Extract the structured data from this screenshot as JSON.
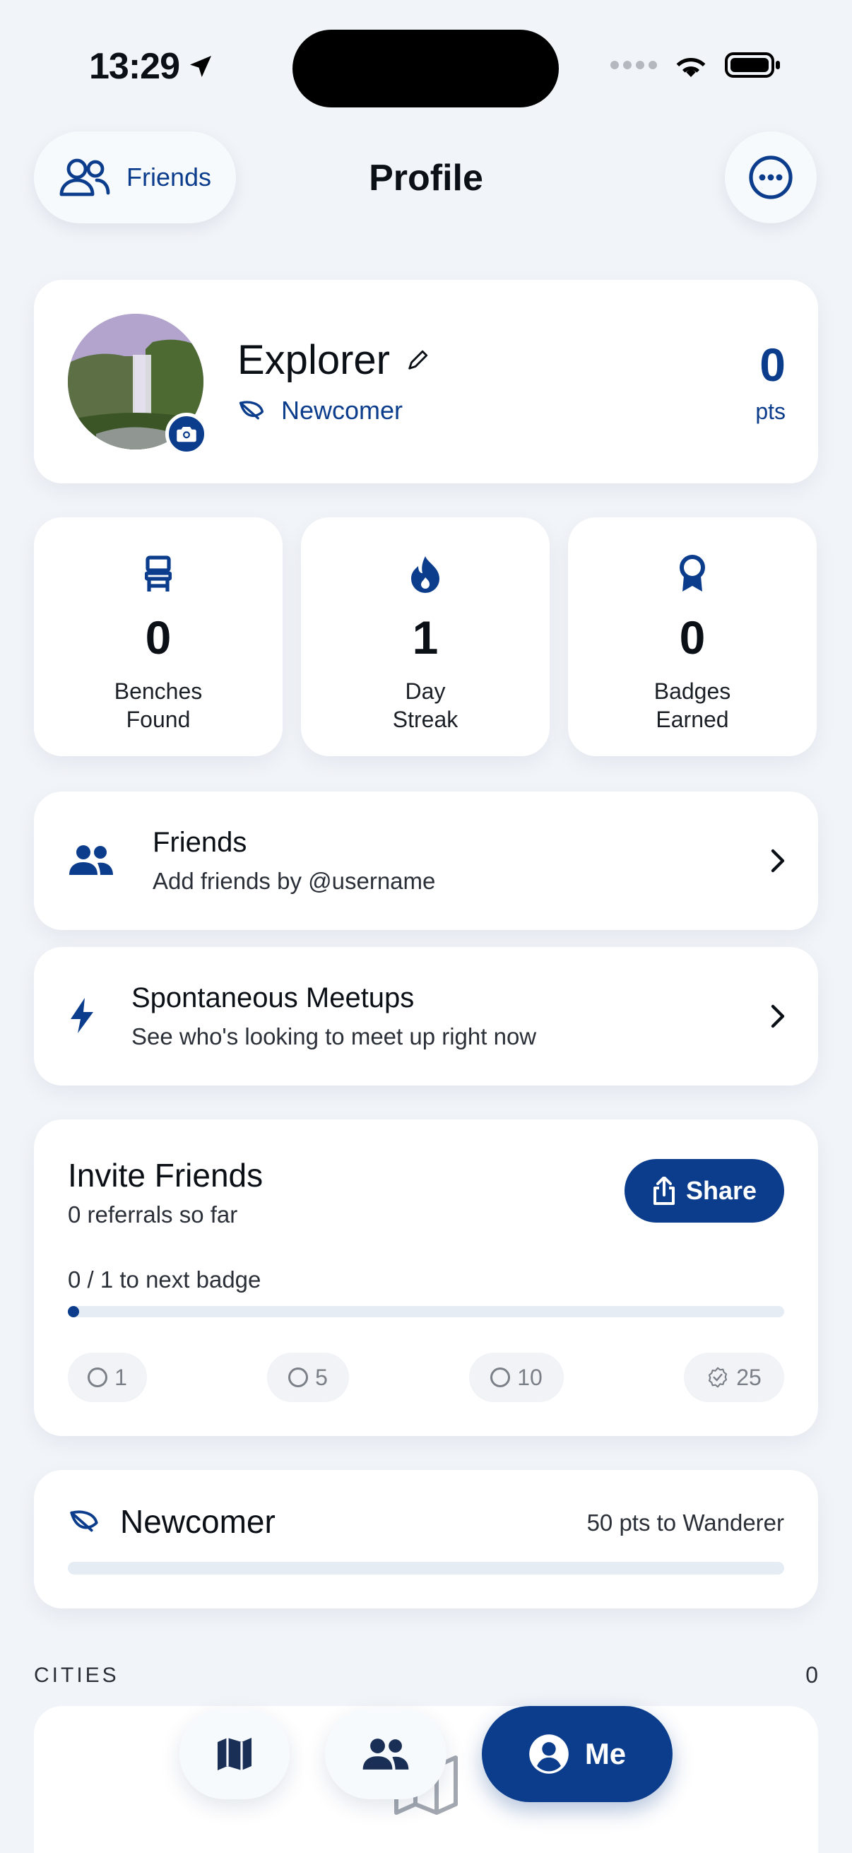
{
  "status_bar": {
    "time": "13:29"
  },
  "header": {
    "friends_label": "Friends",
    "title": "Profile"
  },
  "profile": {
    "name": "Explorer",
    "rank": "Newcomer",
    "points": "0",
    "points_unit": "pts"
  },
  "stats": [
    {
      "value": "0",
      "label": "Benches\nFound",
      "icon": "bench-icon"
    },
    {
      "value": "1",
      "label": "Day\nStreak",
      "icon": "flame-icon"
    },
    {
      "value": "0",
      "label": "Badges\nEarned",
      "icon": "ribbon-icon"
    }
  ],
  "friends_row": {
    "title": "Friends",
    "subtitle": "Add friends by @username"
  },
  "meetups_row": {
    "title": "Spontaneous Meetups",
    "subtitle": "See who's looking to meet up right now"
  },
  "invite": {
    "title": "Invite Friends",
    "subtitle": "0 referrals so far",
    "share_label": "Share",
    "next_badge": "0 / 1 to next badge",
    "progress": 0,
    "milestones": [
      "1",
      "5",
      "10",
      "25"
    ]
  },
  "level": {
    "title": "Newcomer",
    "next": "50 pts to Wanderer",
    "progress": 0
  },
  "cities": {
    "label": "CITIES",
    "count": "0"
  },
  "nav": {
    "me_label": "Me"
  },
  "colors": {
    "accent": "#0b3d8c",
    "background": "#f1f4f8"
  }
}
